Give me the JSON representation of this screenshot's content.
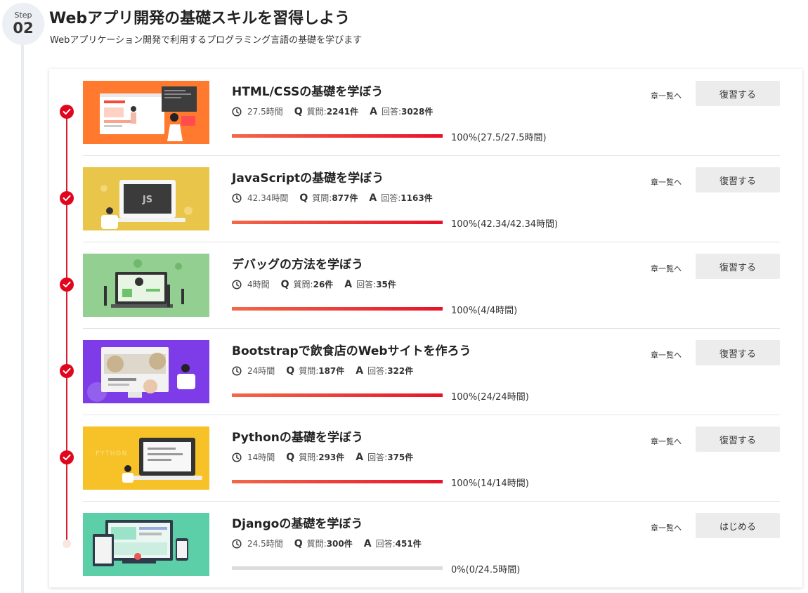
{
  "step": {
    "label": "Step",
    "number": "02",
    "title": "Webアプリ開発の基礎スキルを習得しよう",
    "description": "Webアプリケーション開発で利用するプログラミング言語の基礎を学びます"
  },
  "courses": [
    {
      "title": "HTML/CSSの基礎を学ぼう",
      "hours": "27.5時間",
      "questions_label": "質問:",
      "questions": "2241件",
      "answers_label": "回答:",
      "answers": "3028件",
      "progress_pct": 100,
      "progress_text": "100%(27.5/27.5時間)",
      "chapter_link": "章一覧へ",
      "button": "復習する",
      "status": "completed",
      "thumb_bg": "#ff7a2e"
    },
    {
      "title": "JavaScriptの基礎を学ぼう",
      "hours": "42.34時間",
      "questions_label": "質問:",
      "questions": "877件",
      "answers_label": "回答:",
      "answers": "1163件",
      "progress_pct": 100,
      "progress_text": "100%(42.34/42.34時間)",
      "chapter_link": "章一覧へ",
      "button": "復習する",
      "status": "completed",
      "thumb_bg": "#e9c54a",
      "thumb_text": "JS"
    },
    {
      "title": "デバッグの方法を学ぼう",
      "hours": "4時間",
      "questions_label": "質問:",
      "questions": "26件",
      "answers_label": "回答:",
      "answers": "35件",
      "progress_pct": 100,
      "progress_text": "100%(4/4時間)",
      "chapter_link": "章一覧へ",
      "button": "復習する",
      "status": "completed",
      "thumb_bg": "#93cf91"
    },
    {
      "title": "Bootstrapで飲食店のWebサイトを作ろう",
      "hours": "24時間",
      "questions_label": "質問:",
      "questions": "187件",
      "answers_label": "回答:",
      "answers": "322件",
      "progress_pct": 100,
      "progress_text": "100%(24/24時間)",
      "chapter_link": "章一覧へ",
      "button": "復習する",
      "status": "completed",
      "thumb_bg": "#7d3ce8"
    },
    {
      "title": "Pythonの基礎を学ぼう",
      "hours": "14時間",
      "questions_label": "質問:",
      "questions": "293件",
      "answers_label": "回答:",
      "answers": "375件",
      "progress_pct": 100,
      "progress_text": "100%(14/14時間)",
      "chapter_link": "章一覧へ",
      "button": "復習する",
      "status": "completed",
      "thumb_bg": "#f7c228",
      "thumb_text": "PYTHON"
    },
    {
      "title": "Djangoの基礎を学ぼう",
      "hours": "24.5時間",
      "questions_label": "質問:",
      "questions": "300件",
      "answers_label": "回答:",
      "answers": "451件",
      "progress_pct": 0,
      "progress_text": "0%(0/24.5時間)",
      "chapter_link": "章一覧へ",
      "button": "はじめる",
      "status": "not_started",
      "thumb_bg": "#5ccfa8"
    }
  ],
  "icons": {
    "hours": "clock-icon",
    "questions": "Q",
    "answers": "A",
    "status_completed": "check-circle-icon",
    "status_pending": "pending-dot-icon"
  },
  "colors": {
    "accent": "#e1061d",
    "progress_start": "#f26848",
    "progress_end": "#e8122b",
    "button_bg": "#ececec"
  }
}
